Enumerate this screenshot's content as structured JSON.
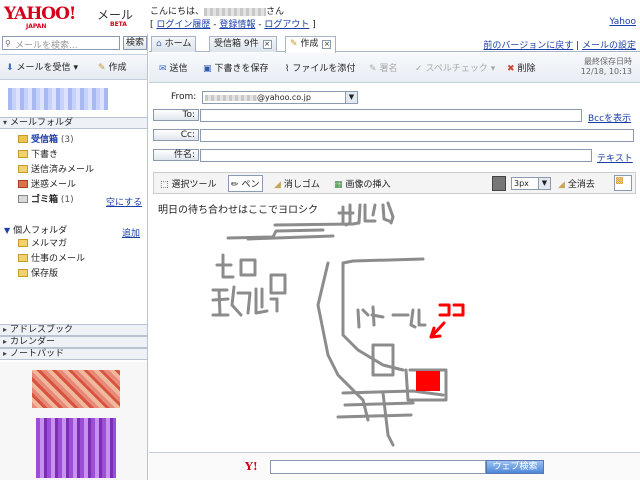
{
  "header": {
    "logo_text": "YAHOO!",
    "logo_sub": "JAPAN",
    "service": "メール",
    "beta": "BETA",
    "greeting_prefix": "こんにちは、",
    "greeting_suffix": "さん",
    "links": [
      "ログイン履歴",
      "登録情報",
      "ログアウト"
    ],
    "yahoo_link": "Yahoo"
  },
  "left": {
    "search_placeholder": "メールを検索...",
    "search_button": "検索",
    "receive_button": "メールを受信",
    "compose_button": "作成",
    "mail_folders_header": "メールフォルダ",
    "folders": [
      {
        "label": "受信箱",
        "count": "(3)"
      },
      {
        "label": "下書き",
        "count": ""
      },
      {
        "label": "送信済みメール",
        "count": ""
      },
      {
        "label": "迷惑メール",
        "count": ""
      },
      {
        "label": "ゴミ箱",
        "count": "(1)"
      }
    ],
    "empty_trash": "空にする",
    "personal_folders_header": "個人フォルダ",
    "add_folder": "追加",
    "personal_folders": [
      "メルマガ",
      "仕事のメール",
      "保存版"
    ],
    "address_book": "アドレスブック",
    "calendar": "カレンダー",
    "notepad": "ノートパッド"
  },
  "tabs": [
    {
      "label": "ホーム"
    },
    {
      "label": "受信箱 9件"
    },
    {
      "label": "作成"
    }
  ],
  "top_right_links": [
    "前のバージョンに戻す",
    "メールの設定"
  ],
  "toolbar": {
    "send": "送信",
    "save_draft": "下書きを保存",
    "attach": "ファイルを添付",
    "signature": "署名",
    "spellcheck": "スペルチェック",
    "delete": "削除",
    "last_saved_label": "最終保存日時",
    "last_saved_time": "12/18, 10:13"
  },
  "form": {
    "from_label": "From:",
    "from_value": "@yahoo.co.jp",
    "to_label": "To:",
    "bcc_link": "Bccを表示",
    "cc_label": "Cc:",
    "subject_label": "件名:",
    "text_link": "テキスト"
  },
  "draw_toolbar": {
    "select": "選択ツール",
    "pen": "ペン",
    "eraser": "消しゴム",
    "insert_image": "画像の挿入",
    "size": "3px",
    "clear_all": "全消去"
  },
  "canvas": {
    "message": "明日の待ち合わせはここでヨロシク",
    "drawn_labels": [
      "駅ビル",
      "北口",
      "改札",
      "ドトール",
      "ココ"
    ],
    "colors": {
      "ink": "#8c8c8c",
      "marker": "#ff0000"
    }
  },
  "bottom": {
    "logo": "Y!",
    "web_search_button": "ウェブ検索"
  }
}
